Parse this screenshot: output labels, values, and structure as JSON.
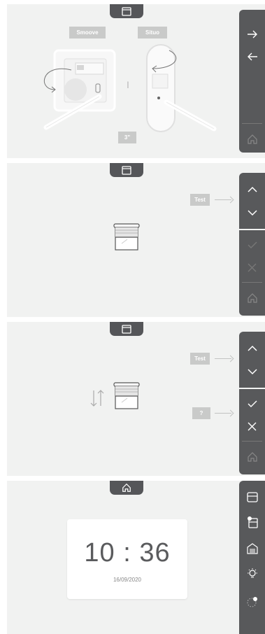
{
  "screen1": {
    "smoove_label": "Smoove",
    "situo_label": "Situo",
    "separator_mark": "I",
    "duration_label": "3\""
  },
  "screen2": {
    "test_label": "Test"
  },
  "screen3": {
    "test_label": "Test",
    "question_label": "?"
  },
  "screen4": {
    "time": "10 : 36",
    "date": "16/09/2020"
  },
  "colors": {
    "panel": "#58595b",
    "background": "#f1f2f1",
    "label_box": "#c9cac9"
  }
}
